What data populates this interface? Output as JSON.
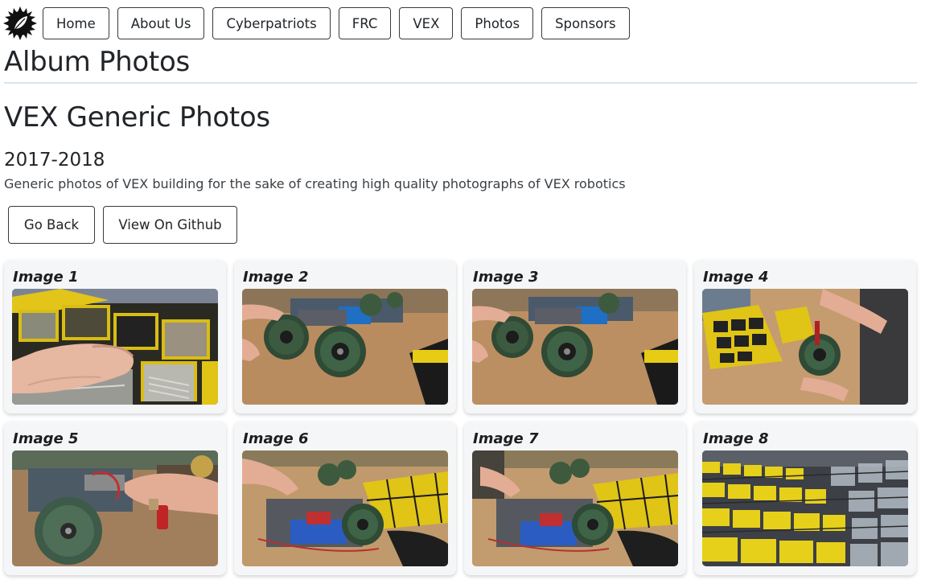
{
  "nav": {
    "logo_icon": "sun-leaf-logo",
    "items": [
      "Home",
      "About Us",
      "Cyberpatriots",
      "FRC",
      "VEX",
      "Photos",
      "Sponsors"
    ]
  },
  "page": {
    "title": "Album Photos",
    "album_title": "VEX Generic Photos",
    "year": "2017-2018",
    "description": "Generic photos of VEX building for the sake of creating high quality photographs of VEX robotics"
  },
  "actions": {
    "back_label": "Go Back",
    "github_label": "View On Github"
  },
  "gallery": {
    "images": [
      {
        "title": "Image 1"
      },
      {
        "title": "Image 2"
      },
      {
        "title": "Image 3"
      },
      {
        "title": "Image 4"
      },
      {
        "title": "Image 5"
      },
      {
        "title": "Image 6"
      },
      {
        "title": "Image 7"
      },
      {
        "title": "Image 8"
      }
    ]
  },
  "colors": {
    "divider": "#d2e6f2",
    "card_bg": "#f5f6f8",
    "border": "#3a3a3a",
    "bin_yellow": "#e6cc14"
  }
}
